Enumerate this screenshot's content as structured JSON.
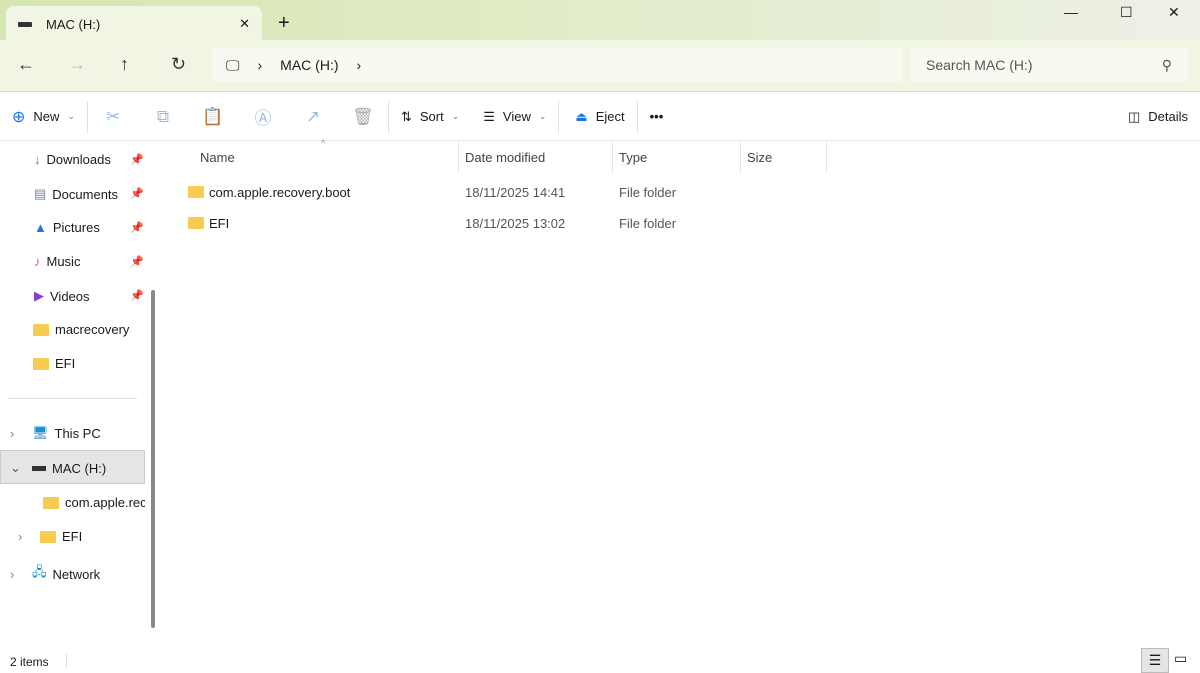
{
  "tab": {
    "title": "MAC (H:)"
  },
  "address": {
    "segments": [
      "MAC (H:)"
    ]
  },
  "search": {
    "placeholder": "Search MAC (H:)"
  },
  "toolbar": {
    "new": "New",
    "sort": "Sort",
    "view": "View",
    "eject": "Eject",
    "more": "•••",
    "details": "Details"
  },
  "sidebar": {
    "quick": [
      {
        "label": "Downloads",
        "icon": "↓"
      },
      {
        "label": "Documents",
        "icon": "▤"
      },
      {
        "label": "Pictures",
        "icon": "▲"
      },
      {
        "label": "Music",
        "icon": "♪"
      },
      {
        "label": "Videos",
        "icon": "▶"
      },
      {
        "label": "macrecovery"
      },
      {
        "label": "EFI"
      }
    ],
    "tree": [
      {
        "label": "This PC"
      },
      {
        "label": "MAC (H:)"
      },
      {
        "label": "com.apple.recovery.boot"
      },
      {
        "label": "EFI"
      },
      {
        "label": "Network"
      }
    ]
  },
  "columns": {
    "name": "Name",
    "date": "Date modified",
    "type": "Type",
    "size": "Size"
  },
  "files": [
    {
      "name": "com.apple.recovery.boot",
      "date": "18/11/2025 14:41",
      "type": "File folder"
    },
    {
      "name": "EFI",
      "date": "18/11/2025 13:02",
      "type": "File folder"
    }
  ],
  "status": {
    "count": "2 items"
  }
}
